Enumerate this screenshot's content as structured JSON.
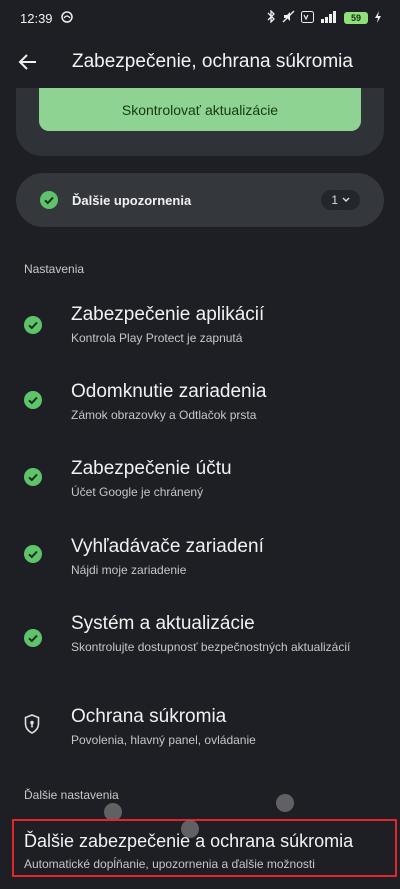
{
  "status_bar": {
    "time": "12:39",
    "battery": "59"
  },
  "header": {
    "title": "Zabezpečenie, ochrana súkromia"
  },
  "update_card": {
    "button_label": "Skontrolovať aktualizácie"
  },
  "alerts": {
    "label": "Ďalšie upozornenia",
    "count": "1"
  },
  "settings": {
    "header": "Nastavenia",
    "items": [
      {
        "title": "Zabezpečenie aplikácií",
        "subtitle": "Kontrola Play Protect je zapnutá"
      },
      {
        "title": "Odomknutie zariadenia",
        "subtitle": "Zámok obrazovky a Odtlačok prsta"
      },
      {
        "title": "Zabezpečenie účtu",
        "subtitle": "Účet Google je chránený"
      },
      {
        "title": "Vyhľadávače zariadení",
        "subtitle": "Nájdi moje zariadenie"
      },
      {
        "title": "Systém a aktualizácie",
        "subtitle": "Skontrolujte dostupnosť bezpečnostných aktualizácií"
      },
      {
        "title": "Ochrana súkromia",
        "subtitle": "Povolenia, hlavný panel, ovládanie"
      }
    ]
  },
  "more_settings": {
    "header": "Ďalšie nastavenia",
    "item": {
      "title": "Ďalšie zabezpečenie a ochrana súkromia",
      "subtitle": "Automatické dopĺňanie, upozornenia a ďalšie možnosti"
    }
  },
  "colors": {
    "background": "#1d1f24",
    "accent_green": "#8ed391",
    "check_green": "#5dc46a",
    "highlight_red": "#e3262b"
  },
  "icons": {
    "back": "arrow-left-icon",
    "check": "check-circle-icon",
    "privacy": "shield-keyhole-icon",
    "dropdown": "chevron-down-icon"
  }
}
